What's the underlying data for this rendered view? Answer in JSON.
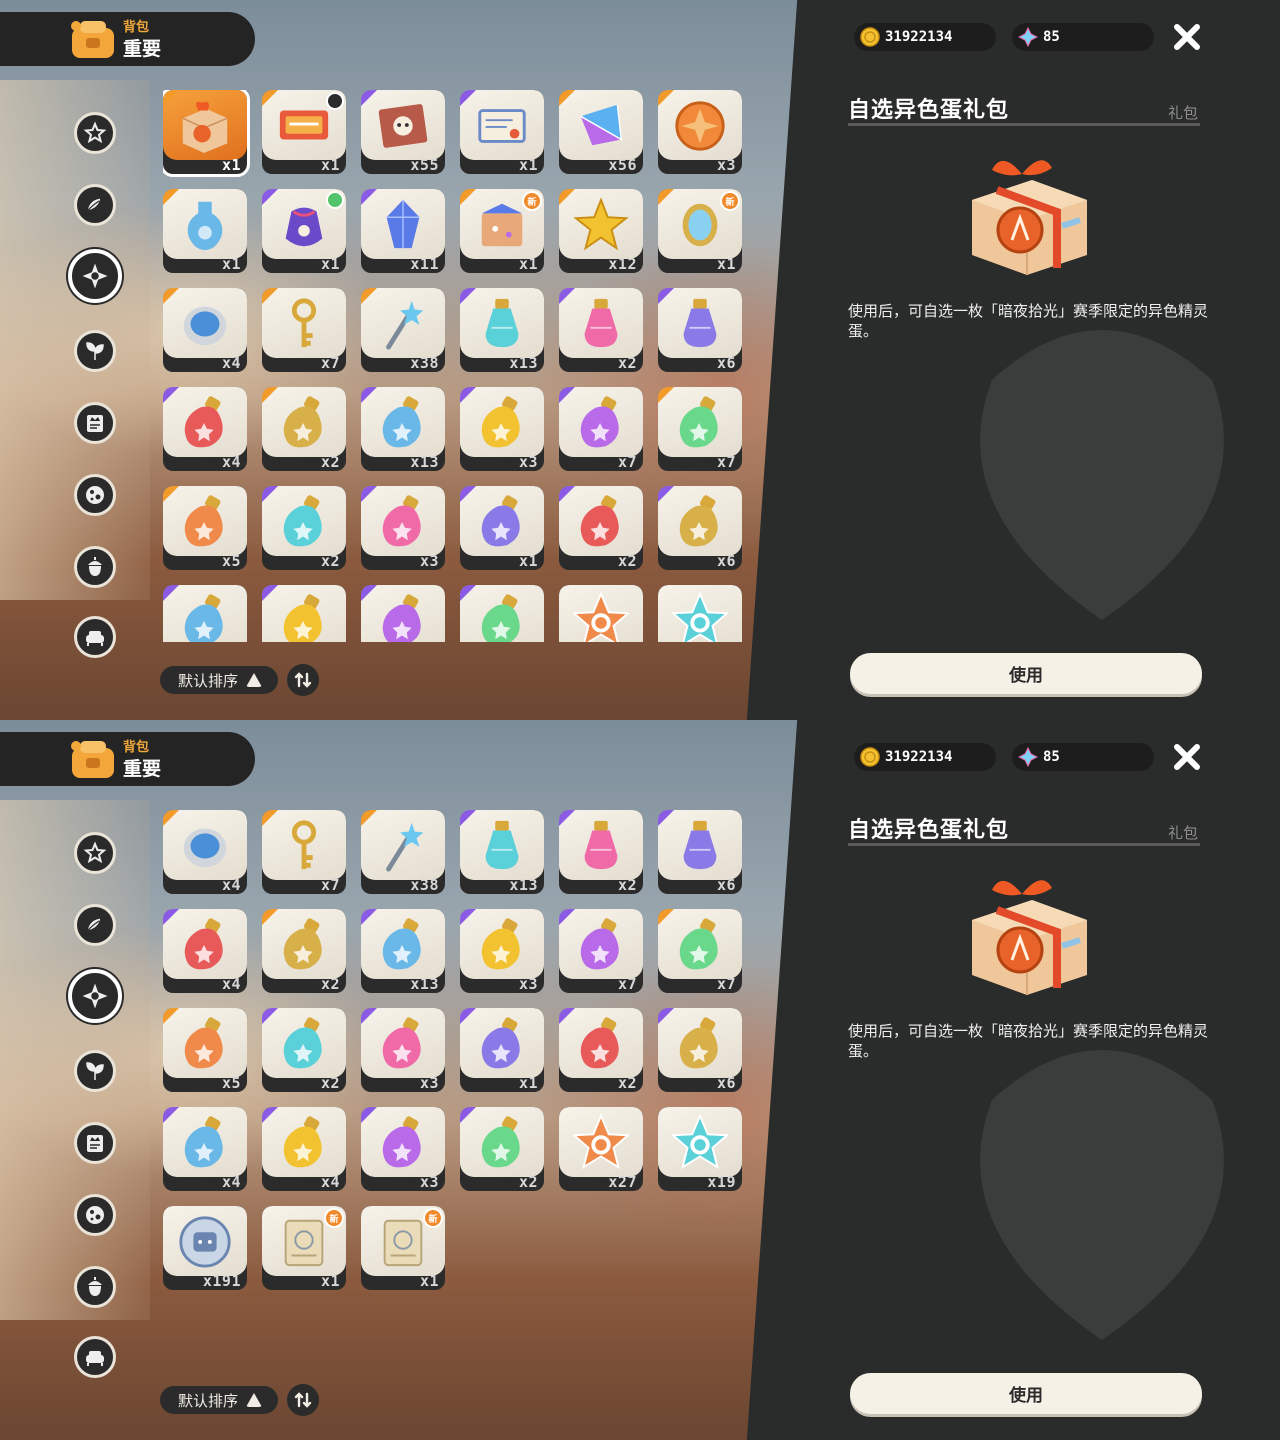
{
  "header": {
    "category_small": "背包",
    "category_big": "重要"
  },
  "currency": {
    "coins": "31922134",
    "gems": "85",
    "coin_icon": "gold-coin-icon",
    "gem_icon": "diamond-gem-icon"
  },
  "detail": {
    "title": "自选异色蛋礼包",
    "type": "礼包",
    "description": "使用后，可自选一枚「暗夜拾光」赛季限定的异色精灵蛋。",
    "use_label": "使用"
  },
  "sort": {
    "label": "默认排序"
  },
  "side_categories": [
    {
      "icon": "star-badge-icon"
    },
    {
      "icon": "leaf-swirl-icon"
    },
    {
      "icon": "sparkle-star-icon",
      "active": true
    },
    {
      "icon": "plant-leaves-icon"
    },
    {
      "icon": "crown-card-icon"
    },
    {
      "icon": "spotted-ball-icon"
    },
    {
      "icon": "acorn-icon"
    },
    {
      "icon": "sofa-icon"
    }
  ],
  "items": [
    {
      "name": "自选异色蛋礼包",
      "qty": "x1",
      "art": "gift-box",
      "rarity": "orange"
    },
    {
      "name": "ticket-red",
      "qty": "x1",
      "art": "ticket",
      "rarity": "orange",
      "badge": "clock"
    },
    {
      "name": "card-bunny",
      "qty": "x55",
      "art": "card",
      "rarity": "purple"
    },
    {
      "name": "letter",
      "qty": "x1",
      "art": "letter",
      "rarity": "purple"
    },
    {
      "name": "blue-prism",
      "qty": "x56",
      "art": "prism",
      "rarity": "orange"
    },
    {
      "name": "orange-emblem",
      "qty": "x3",
      "art": "emblem",
      "rarity": "orange"
    },
    {
      "name": "blue-flask",
      "qty": "x1",
      "art": "flask",
      "rarity": "orange"
    },
    {
      "name": "purple-pouch",
      "qty": "x1",
      "art": "pouch",
      "rarity": "purple",
      "badge": "green"
    },
    {
      "name": "crystal-shard",
      "qty": "x11",
      "art": "crystal",
      "rarity": "purple"
    },
    {
      "name": "star-box",
      "qty": "x1",
      "art": "box",
      "rarity": "orange",
      "badge": "new"
    },
    {
      "name": "gold-star",
      "qty": "x12",
      "art": "star",
      "rarity": "orange"
    },
    {
      "name": "mirror",
      "qty": "x1",
      "art": "mirror",
      "rarity": "orange",
      "badge": "new"
    },
    {
      "name": "blue-orb",
      "qty": "x4",
      "art": "orb",
      "rarity": "orange"
    },
    {
      "name": "gold-key",
      "qty": "x7",
      "art": "key",
      "rarity": "orange"
    },
    {
      "name": "star-wand",
      "qty": "x38",
      "art": "wand",
      "rarity": "orange"
    },
    {
      "name": "rainbow-potion",
      "qty": "x13",
      "art": "potion",
      "rarity": "purple"
    },
    {
      "name": "red-potion",
      "qty": "x2",
      "art": "potion",
      "rarity": "purple"
    },
    {
      "name": "prism-potion",
      "qty": "x6",
      "art": "potion",
      "rarity": "purple"
    },
    {
      "name": "blue-bottle",
      "qty": "x4",
      "art": "bottle",
      "rarity": "purple"
    },
    {
      "name": "blue-star-bottle",
      "qty": "x2",
      "art": "bottle",
      "rarity": "orange"
    },
    {
      "name": "green-bottle",
      "qty": "x13",
      "art": "bottle",
      "rarity": "purple"
    },
    {
      "name": "red-bottle",
      "qty": "x3",
      "art": "bottle",
      "rarity": "purple"
    },
    {
      "name": "azure-bottle",
      "qty": "x7",
      "art": "bottle",
      "rarity": "purple"
    },
    {
      "name": "gold-bottle",
      "qty": "x7",
      "art": "bottle",
      "rarity": "orange"
    },
    {
      "name": "cyan-bottle",
      "qty": "x5",
      "art": "bottle",
      "rarity": "orange"
    },
    {
      "name": "yellow-bottle",
      "qty": "x2",
      "art": "bottle",
      "rarity": "purple"
    },
    {
      "name": "violet-bottle",
      "qty": "x3",
      "art": "bottle",
      "rarity": "purple"
    },
    {
      "name": "lime-bottle",
      "qty": "x1",
      "art": "bottle",
      "rarity": "purple"
    },
    {
      "name": "amber-bottle",
      "qty": "x2",
      "art": "bottle",
      "rarity": "purple"
    },
    {
      "name": "teal-bottle",
      "qty": "x6",
      "art": "bottle",
      "rarity": "purple"
    },
    {
      "name": "pink-bottle",
      "qty": "x4",
      "art": "bottle",
      "rarity": "purple"
    },
    {
      "name": "purple-bottle",
      "qty": "x4",
      "art": "bottle",
      "rarity": "purple"
    },
    {
      "name": "mint-bottle",
      "qty": "x3",
      "art": "bottle",
      "rarity": "purple"
    },
    {
      "name": "swirl-bottle",
      "qty": "x2",
      "art": "bottle",
      "rarity": "purple"
    },
    {
      "name": "blue-star-token",
      "qty": "x27",
      "art": "startoken",
      "rarity": "none"
    },
    {
      "name": "gold-star-token",
      "qty": "x19",
      "art": "startoken",
      "rarity": "none"
    },
    {
      "name": "robot-coin",
      "qty": "x191",
      "art": "coin",
      "rarity": "none"
    },
    {
      "name": "scroll-a",
      "qty": "x1",
      "art": "scroll",
      "rarity": "none",
      "badge": "new"
    },
    {
      "name": "scroll-b",
      "qty": "x1",
      "art": "scroll",
      "rarity": "none",
      "badge": "new"
    }
  ],
  "colors": {
    "selected": "#e97a22",
    "panel": "#2a2c2b",
    "accent_orange": "#f29b2a",
    "accent_purple": "#8b5be6",
    "new_badge": "#f08a2a"
  }
}
